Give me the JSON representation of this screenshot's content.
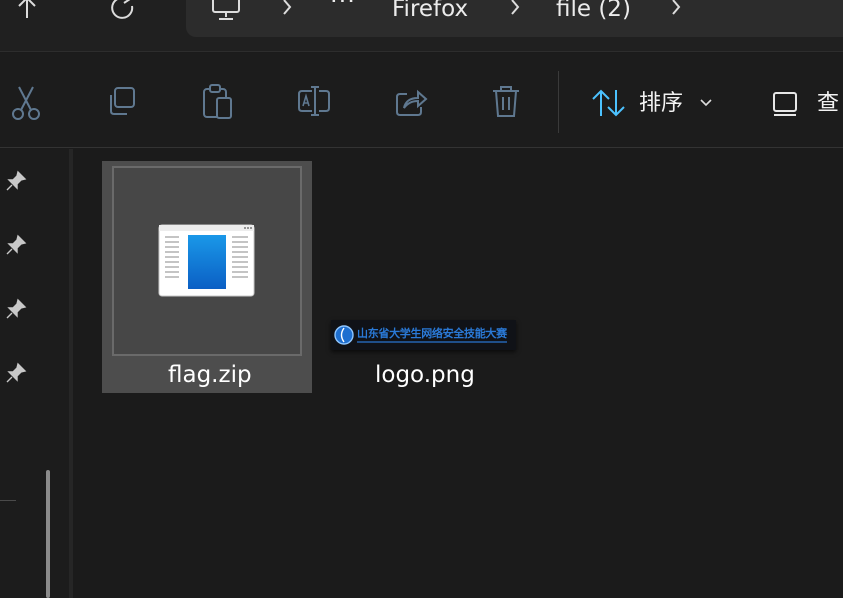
{
  "address_bar": {
    "breadcrumb": [
      "Firefox",
      "file (2)"
    ],
    "more_label": "···"
  },
  "toolbar": {
    "sort_label": "排序",
    "view_label": "查"
  },
  "files": [
    {
      "name": "flag.zip",
      "selected": true,
      "icon": "zip-file-icon"
    },
    {
      "name": "logo.png",
      "selected": false,
      "icon": "image-thumbnail"
    }
  ],
  "logo_thumbnail": {
    "text": "山东省大学生网络安全技能大赛",
    "color": "#2a79d6"
  },
  "colors": {
    "accent": "#0078d4",
    "sort_arrows": "#4cc2ff"
  },
  "icons": [
    "up-arrow-icon",
    "refresh-icon",
    "this-pc-icon",
    "chevron-right-icon",
    "cut-icon",
    "copy-icon",
    "paste-icon",
    "rename-icon",
    "share-icon",
    "delete-icon",
    "sort-icon",
    "chevron-down-icon",
    "view-checkbox-icon",
    "pin-icon"
  ]
}
